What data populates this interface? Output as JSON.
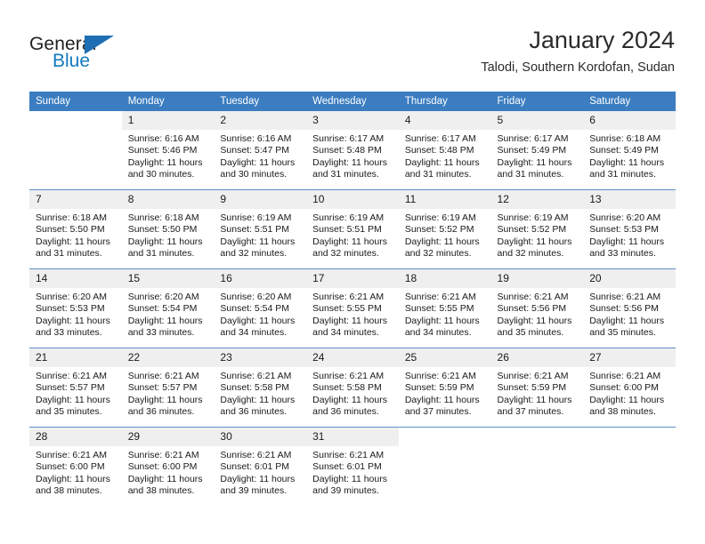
{
  "brand": {
    "name_part1": "General",
    "name_part2": "Blue"
  },
  "header": {
    "title": "January 2024",
    "subtitle": "Talodi, Southern Kordofan, Sudan"
  },
  "colors": {
    "header_blue": "#3b7dc0",
    "brand_blue": "#1279bf",
    "daynum_gray": "#efefef",
    "row_divider": "#5b8fc9"
  },
  "weekdays": [
    "Sunday",
    "Monday",
    "Tuesday",
    "Wednesday",
    "Thursday",
    "Friday",
    "Saturday"
  ],
  "weeks": [
    [
      {
        "day": "",
        "sunrise": "",
        "sunset": "",
        "daylight1": "",
        "daylight2": "",
        "blank": true
      },
      {
        "day": "1",
        "sunrise": "Sunrise: 6:16 AM",
        "sunset": "Sunset: 5:46 PM",
        "daylight1": "Daylight: 11 hours",
        "daylight2": "and 30 minutes."
      },
      {
        "day": "2",
        "sunrise": "Sunrise: 6:16 AM",
        "sunset": "Sunset: 5:47 PM",
        "daylight1": "Daylight: 11 hours",
        "daylight2": "and 30 minutes."
      },
      {
        "day": "3",
        "sunrise": "Sunrise: 6:17 AM",
        "sunset": "Sunset: 5:48 PM",
        "daylight1": "Daylight: 11 hours",
        "daylight2": "and 31 minutes."
      },
      {
        "day": "4",
        "sunrise": "Sunrise: 6:17 AM",
        "sunset": "Sunset: 5:48 PM",
        "daylight1": "Daylight: 11 hours",
        "daylight2": "and 31 minutes."
      },
      {
        "day": "5",
        "sunrise": "Sunrise: 6:17 AM",
        "sunset": "Sunset: 5:49 PM",
        "daylight1": "Daylight: 11 hours",
        "daylight2": "and 31 minutes."
      },
      {
        "day": "6",
        "sunrise": "Sunrise: 6:18 AM",
        "sunset": "Sunset: 5:49 PM",
        "daylight1": "Daylight: 11 hours",
        "daylight2": "and 31 minutes."
      }
    ],
    [
      {
        "day": "7",
        "sunrise": "Sunrise: 6:18 AM",
        "sunset": "Sunset: 5:50 PM",
        "daylight1": "Daylight: 11 hours",
        "daylight2": "and 31 minutes."
      },
      {
        "day": "8",
        "sunrise": "Sunrise: 6:18 AM",
        "sunset": "Sunset: 5:50 PM",
        "daylight1": "Daylight: 11 hours",
        "daylight2": "and 31 minutes."
      },
      {
        "day": "9",
        "sunrise": "Sunrise: 6:19 AM",
        "sunset": "Sunset: 5:51 PM",
        "daylight1": "Daylight: 11 hours",
        "daylight2": "and 32 minutes."
      },
      {
        "day": "10",
        "sunrise": "Sunrise: 6:19 AM",
        "sunset": "Sunset: 5:51 PM",
        "daylight1": "Daylight: 11 hours",
        "daylight2": "and 32 minutes."
      },
      {
        "day": "11",
        "sunrise": "Sunrise: 6:19 AM",
        "sunset": "Sunset: 5:52 PM",
        "daylight1": "Daylight: 11 hours",
        "daylight2": "and 32 minutes."
      },
      {
        "day": "12",
        "sunrise": "Sunrise: 6:19 AM",
        "sunset": "Sunset: 5:52 PM",
        "daylight1": "Daylight: 11 hours",
        "daylight2": "and 32 minutes."
      },
      {
        "day": "13",
        "sunrise": "Sunrise: 6:20 AM",
        "sunset": "Sunset: 5:53 PM",
        "daylight1": "Daylight: 11 hours",
        "daylight2": "and 33 minutes."
      }
    ],
    [
      {
        "day": "14",
        "sunrise": "Sunrise: 6:20 AM",
        "sunset": "Sunset: 5:53 PM",
        "daylight1": "Daylight: 11 hours",
        "daylight2": "and 33 minutes."
      },
      {
        "day": "15",
        "sunrise": "Sunrise: 6:20 AM",
        "sunset": "Sunset: 5:54 PM",
        "daylight1": "Daylight: 11 hours",
        "daylight2": "and 33 minutes."
      },
      {
        "day": "16",
        "sunrise": "Sunrise: 6:20 AM",
        "sunset": "Sunset: 5:54 PM",
        "daylight1": "Daylight: 11 hours",
        "daylight2": "and 34 minutes."
      },
      {
        "day": "17",
        "sunrise": "Sunrise: 6:21 AM",
        "sunset": "Sunset: 5:55 PM",
        "daylight1": "Daylight: 11 hours",
        "daylight2": "and 34 minutes."
      },
      {
        "day": "18",
        "sunrise": "Sunrise: 6:21 AM",
        "sunset": "Sunset: 5:55 PM",
        "daylight1": "Daylight: 11 hours",
        "daylight2": "and 34 minutes."
      },
      {
        "day": "19",
        "sunrise": "Sunrise: 6:21 AM",
        "sunset": "Sunset: 5:56 PM",
        "daylight1": "Daylight: 11 hours",
        "daylight2": "and 35 minutes."
      },
      {
        "day": "20",
        "sunrise": "Sunrise: 6:21 AM",
        "sunset": "Sunset: 5:56 PM",
        "daylight1": "Daylight: 11 hours",
        "daylight2": "and 35 minutes."
      }
    ],
    [
      {
        "day": "21",
        "sunrise": "Sunrise: 6:21 AM",
        "sunset": "Sunset: 5:57 PM",
        "daylight1": "Daylight: 11 hours",
        "daylight2": "and 35 minutes."
      },
      {
        "day": "22",
        "sunrise": "Sunrise: 6:21 AM",
        "sunset": "Sunset: 5:57 PM",
        "daylight1": "Daylight: 11 hours",
        "daylight2": "and 36 minutes."
      },
      {
        "day": "23",
        "sunrise": "Sunrise: 6:21 AM",
        "sunset": "Sunset: 5:58 PM",
        "daylight1": "Daylight: 11 hours",
        "daylight2": "and 36 minutes."
      },
      {
        "day": "24",
        "sunrise": "Sunrise: 6:21 AM",
        "sunset": "Sunset: 5:58 PM",
        "daylight1": "Daylight: 11 hours",
        "daylight2": "and 36 minutes."
      },
      {
        "day": "25",
        "sunrise": "Sunrise: 6:21 AM",
        "sunset": "Sunset: 5:59 PM",
        "daylight1": "Daylight: 11 hours",
        "daylight2": "and 37 minutes."
      },
      {
        "day": "26",
        "sunrise": "Sunrise: 6:21 AM",
        "sunset": "Sunset: 5:59 PM",
        "daylight1": "Daylight: 11 hours",
        "daylight2": "and 37 minutes."
      },
      {
        "day": "27",
        "sunrise": "Sunrise: 6:21 AM",
        "sunset": "Sunset: 6:00 PM",
        "daylight1": "Daylight: 11 hours",
        "daylight2": "and 38 minutes."
      }
    ],
    [
      {
        "day": "28",
        "sunrise": "Sunrise: 6:21 AM",
        "sunset": "Sunset: 6:00 PM",
        "daylight1": "Daylight: 11 hours",
        "daylight2": "and 38 minutes."
      },
      {
        "day": "29",
        "sunrise": "Sunrise: 6:21 AM",
        "sunset": "Sunset: 6:00 PM",
        "daylight1": "Daylight: 11 hours",
        "daylight2": "and 38 minutes."
      },
      {
        "day": "30",
        "sunrise": "Sunrise: 6:21 AM",
        "sunset": "Sunset: 6:01 PM",
        "daylight1": "Daylight: 11 hours",
        "daylight2": "and 39 minutes."
      },
      {
        "day": "31",
        "sunrise": "Sunrise: 6:21 AM",
        "sunset": "Sunset: 6:01 PM",
        "daylight1": "Daylight: 11 hours",
        "daylight2": "and 39 minutes."
      },
      {
        "day": "",
        "sunrise": "",
        "sunset": "",
        "daylight1": "",
        "daylight2": "",
        "blank": true
      },
      {
        "day": "",
        "sunrise": "",
        "sunset": "",
        "daylight1": "",
        "daylight2": "",
        "blank": true
      },
      {
        "day": "",
        "sunrise": "",
        "sunset": "",
        "daylight1": "",
        "daylight2": "",
        "blank": true
      }
    ]
  ]
}
